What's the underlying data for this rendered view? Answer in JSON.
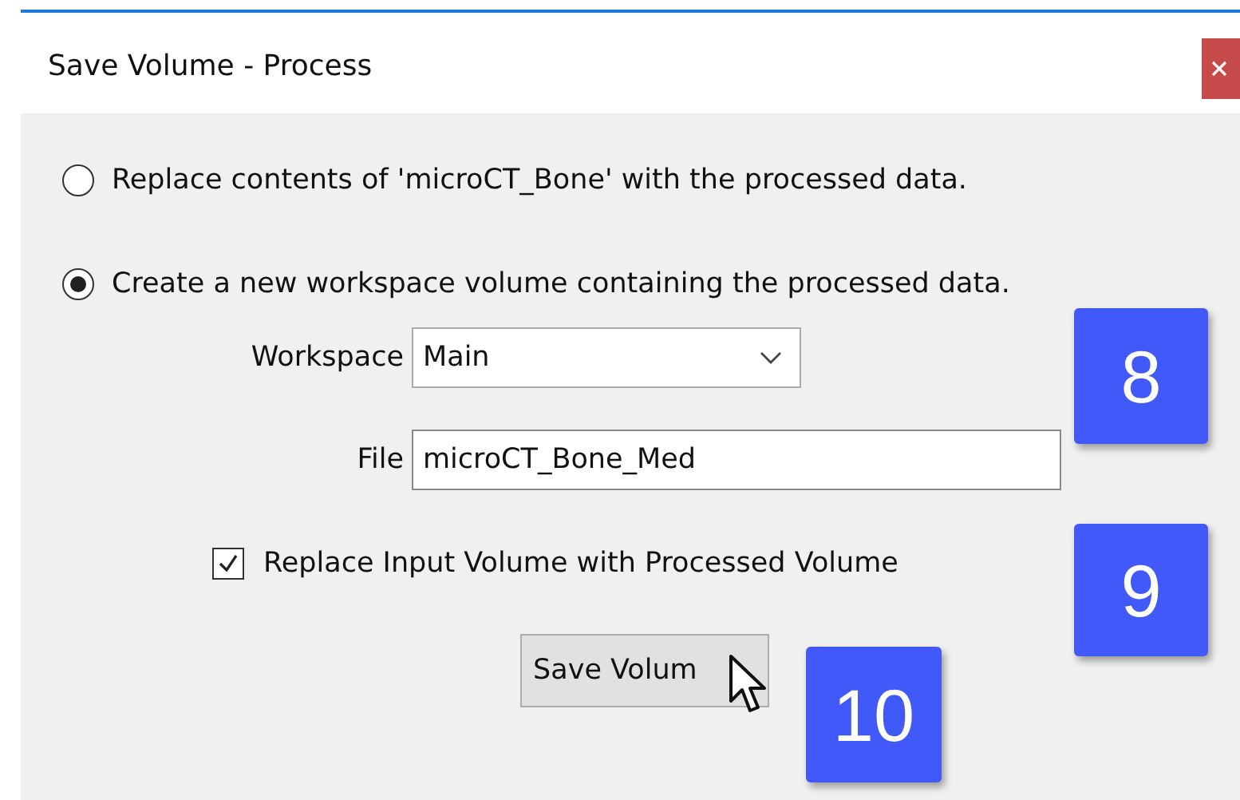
{
  "window": {
    "title": "Save Volume - Process"
  },
  "options": [
    {
      "label": "Replace contents of 'microCT_Bone' with the processed data.",
      "selected": false
    },
    {
      "label": "Create a new workspace volume containing the processed data.",
      "selected": true
    }
  ],
  "workspace": {
    "label": "Workspace",
    "value": "Main"
  },
  "file": {
    "label": "File",
    "value": "microCT_Bone_Med"
  },
  "replace_input": {
    "label": "Replace Input Volume with Processed Volume",
    "checked": true
  },
  "save_button": {
    "label": "Save Volum"
  },
  "callouts": [
    "8",
    "9",
    "10"
  ]
}
